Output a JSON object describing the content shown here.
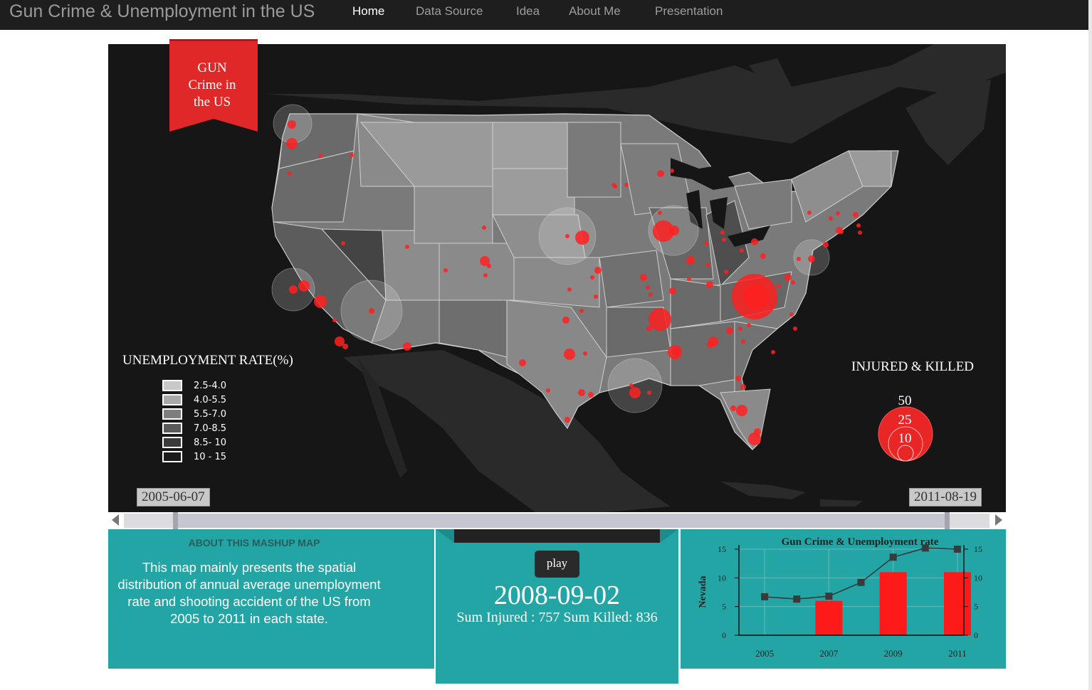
{
  "nav": {
    "brand": "Gun Crime & Unemployment in the US",
    "items": [
      {
        "label": "Home",
        "active": true
      },
      {
        "label": "Data Source",
        "active": false
      },
      {
        "label": "Idea",
        "active": false
      },
      {
        "label": "About Me",
        "active": false
      },
      {
        "label": "Presentation",
        "active": false
      }
    ]
  },
  "map": {
    "ribbon_lines": [
      "GUN",
      "Crime in",
      "the US"
    ],
    "unemployment_legend": {
      "title": "UNEMPLOYMENT RATE(%)",
      "items": [
        {
          "label": "2.5-4.0",
          "color": "#c8c8c8"
        },
        {
          "label": "4.0-5.5",
          "color": "#a8a8a8"
        },
        {
          "label": "5.5-7.0",
          "color": "#7e7e7e"
        },
        {
          "label": "7.0-8.5",
          "color": "#5a5a5a"
        },
        {
          "label": "8.5- 10",
          "color": "#3a3a3a"
        },
        {
          "label": "10 - 15",
          "color": "#1a1a1a"
        }
      ]
    },
    "size_legend": {
      "title": "INJURED & KILLED",
      "values": [
        "50",
        "25",
        "10"
      ]
    },
    "colors": {
      "point": "#ff2020",
      "ocean": "#161616"
    }
  },
  "timeline": {
    "start_label": "2005-06-07",
    "end_label": "2011-08-19"
  },
  "about": {
    "title": "ABOUT THIS MASHUP MAP",
    "body": "This map mainly presents the spatial distribution of annual average unemployment rate and shooting accident of the US from 2005 to 2011 in each state."
  },
  "player": {
    "play_label": "play",
    "current_date": "2008-09-02",
    "sum_text": "Sum Injured : 757    Sum Killed: 836"
  },
  "chart_data": {
    "type": "bar",
    "title": "Gun Crime & Unemployment rate",
    "ylabel": "Nevada",
    "x_tick_labels": [
      "2005",
      "2007",
      "2009",
      "2011"
    ],
    "y_ticks": [
      0,
      5,
      10,
      15
    ],
    "ylim": [
      0,
      15
    ],
    "xlim": [
      2004.2,
      2011.2
    ],
    "bars": {
      "x": [
        2007,
        2009,
        2011
      ],
      "values": [
        6,
        11,
        11
      ],
      "color": "#ff1a1a"
    },
    "line": {
      "x": [
        2005,
        2006,
        2007,
        2008,
        2009,
        2010,
        2011
      ],
      "values": [
        6.7,
        6.3,
        6.8,
        9.2,
        13.6,
        15.2,
        15.0
      ],
      "color": "#333333"
    }
  }
}
